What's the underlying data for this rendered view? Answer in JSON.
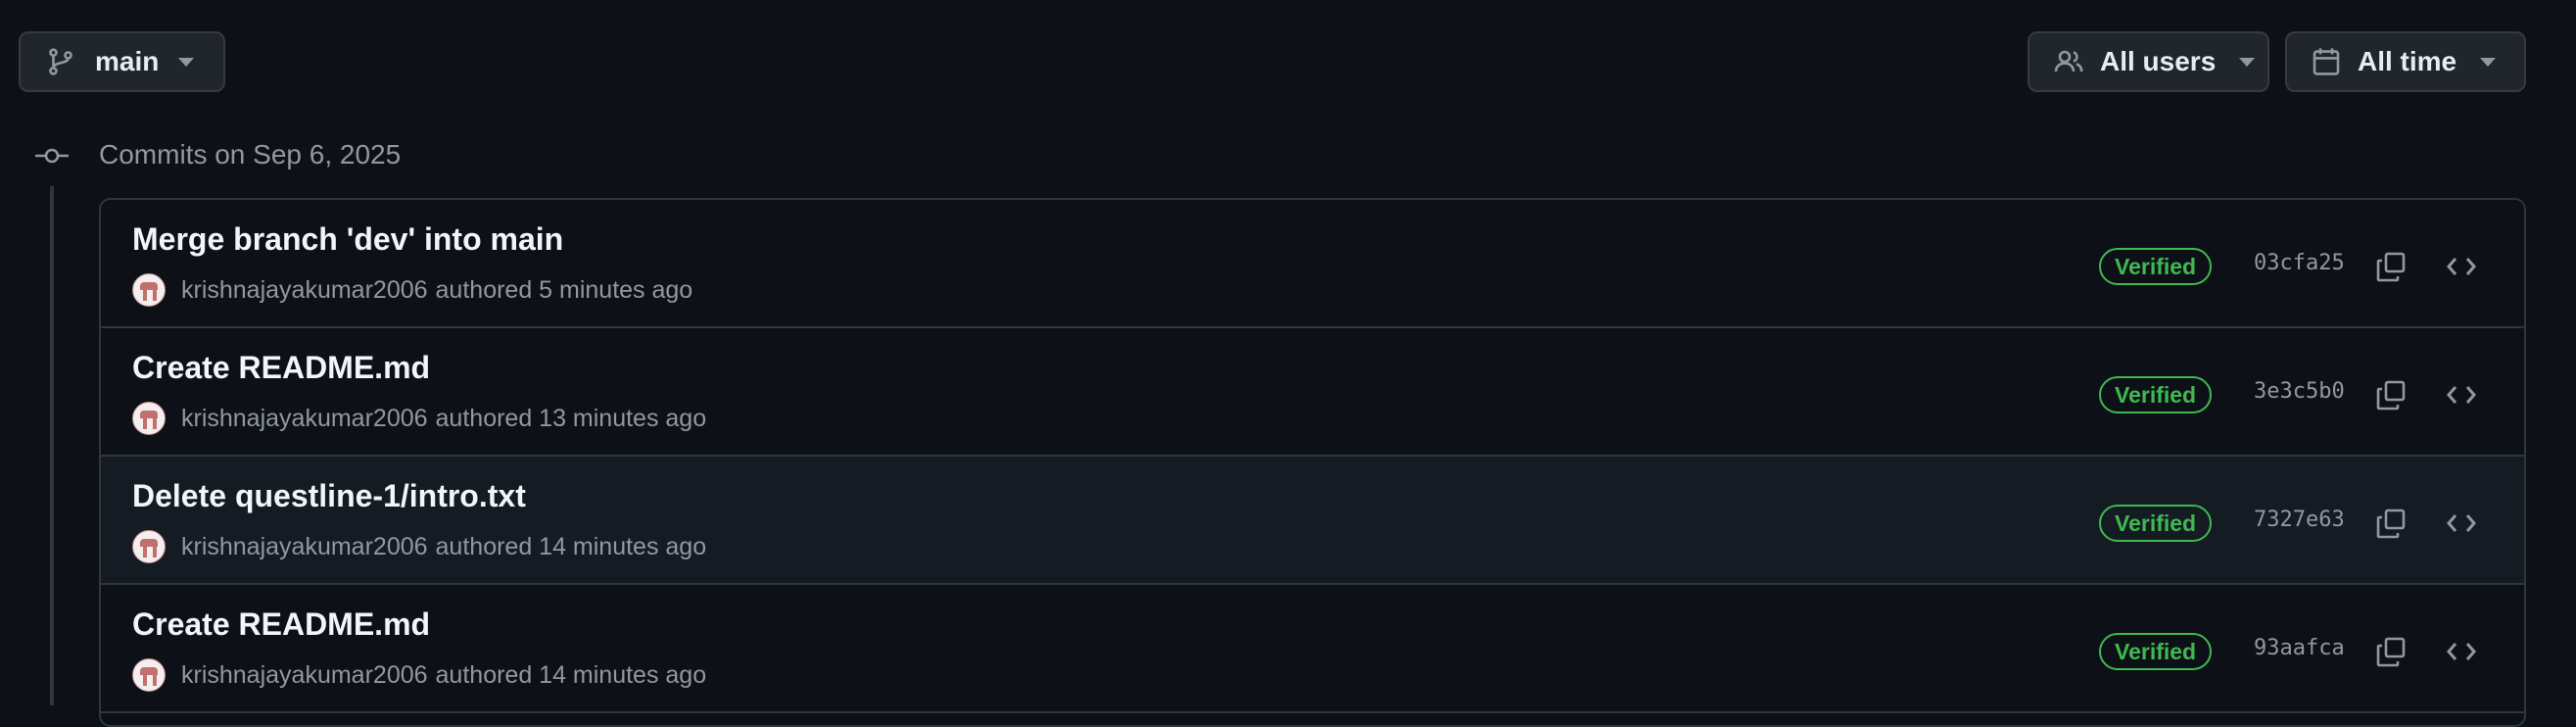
{
  "toolbar": {
    "branch_label": "main",
    "users_label": "All users",
    "time_label": "All time"
  },
  "group": {
    "title": "Commits on Sep 6, 2025"
  },
  "commits": [
    {
      "title": "Merge branch 'dev' into main",
      "author": "krishnajayakumar2006",
      "time": "authored 5 minutes ago",
      "badge": "Verified",
      "sha": "03cfa25"
    },
    {
      "title": "Create README.md",
      "author": "krishnajayakumar2006",
      "time": "authored 13 minutes ago",
      "badge": "Verified",
      "sha": "3e3c5b0"
    },
    {
      "title": "Delete questline-1/intro.txt",
      "author": "krishnajayakumar2006",
      "time": "authored 14 minutes ago",
      "badge": "Verified",
      "sha": "7327e63"
    },
    {
      "title": "Create README.md",
      "author": "krishnajayakumar2006",
      "time": "authored 14 minutes ago",
      "badge": "Verified",
      "sha": "93aafca"
    }
  ],
  "colors": {
    "background": "#0d1117",
    "verified": "#3fb950",
    "border": "#30363d"
  },
  "icons": [
    "git-branch-icon",
    "people-icon",
    "calendar-icon",
    "git-commit-icon",
    "copy-icon",
    "code-icon",
    "caret-down-icon"
  ]
}
